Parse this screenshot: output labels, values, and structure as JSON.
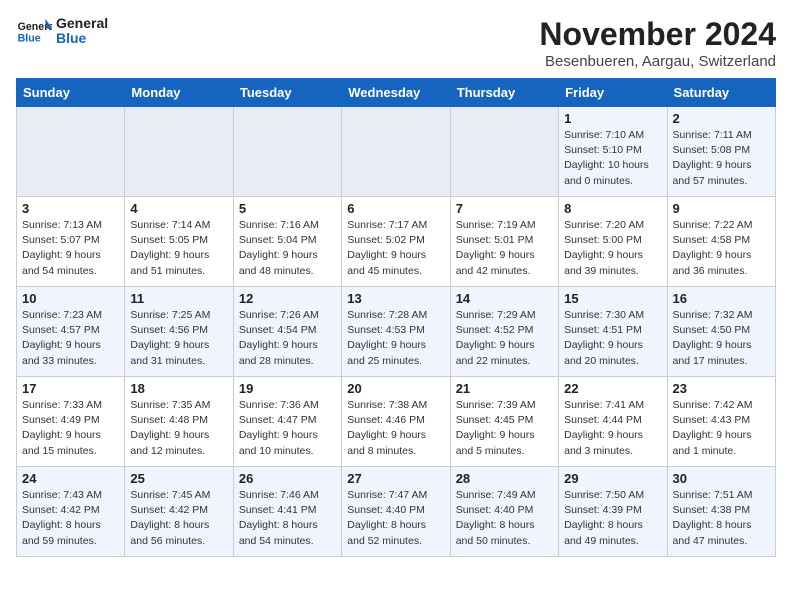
{
  "logo": {
    "line1": "General",
    "line2": "Blue"
  },
  "title": "November 2024",
  "location": "Besenbueren, Aargau, Switzerland",
  "weekdays": [
    "Sunday",
    "Monday",
    "Tuesday",
    "Wednesday",
    "Thursday",
    "Friday",
    "Saturday"
  ],
  "weeks": [
    [
      {
        "day": "",
        "info": ""
      },
      {
        "day": "",
        "info": ""
      },
      {
        "day": "",
        "info": ""
      },
      {
        "day": "",
        "info": ""
      },
      {
        "day": "",
        "info": ""
      },
      {
        "day": "1",
        "info": "Sunrise: 7:10 AM\nSunset: 5:10 PM\nDaylight: 10 hours\nand 0 minutes."
      },
      {
        "day": "2",
        "info": "Sunrise: 7:11 AM\nSunset: 5:08 PM\nDaylight: 9 hours\nand 57 minutes."
      }
    ],
    [
      {
        "day": "3",
        "info": "Sunrise: 7:13 AM\nSunset: 5:07 PM\nDaylight: 9 hours\nand 54 minutes."
      },
      {
        "day": "4",
        "info": "Sunrise: 7:14 AM\nSunset: 5:05 PM\nDaylight: 9 hours\nand 51 minutes."
      },
      {
        "day": "5",
        "info": "Sunrise: 7:16 AM\nSunset: 5:04 PM\nDaylight: 9 hours\nand 48 minutes."
      },
      {
        "day": "6",
        "info": "Sunrise: 7:17 AM\nSunset: 5:02 PM\nDaylight: 9 hours\nand 45 minutes."
      },
      {
        "day": "7",
        "info": "Sunrise: 7:19 AM\nSunset: 5:01 PM\nDaylight: 9 hours\nand 42 minutes."
      },
      {
        "day": "8",
        "info": "Sunrise: 7:20 AM\nSunset: 5:00 PM\nDaylight: 9 hours\nand 39 minutes."
      },
      {
        "day": "9",
        "info": "Sunrise: 7:22 AM\nSunset: 4:58 PM\nDaylight: 9 hours\nand 36 minutes."
      }
    ],
    [
      {
        "day": "10",
        "info": "Sunrise: 7:23 AM\nSunset: 4:57 PM\nDaylight: 9 hours\nand 33 minutes."
      },
      {
        "day": "11",
        "info": "Sunrise: 7:25 AM\nSunset: 4:56 PM\nDaylight: 9 hours\nand 31 minutes."
      },
      {
        "day": "12",
        "info": "Sunrise: 7:26 AM\nSunset: 4:54 PM\nDaylight: 9 hours\nand 28 minutes."
      },
      {
        "day": "13",
        "info": "Sunrise: 7:28 AM\nSunset: 4:53 PM\nDaylight: 9 hours\nand 25 minutes."
      },
      {
        "day": "14",
        "info": "Sunrise: 7:29 AM\nSunset: 4:52 PM\nDaylight: 9 hours\nand 22 minutes."
      },
      {
        "day": "15",
        "info": "Sunrise: 7:30 AM\nSunset: 4:51 PM\nDaylight: 9 hours\nand 20 minutes."
      },
      {
        "day": "16",
        "info": "Sunrise: 7:32 AM\nSunset: 4:50 PM\nDaylight: 9 hours\nand 17 minutes."
      }
    ],
    [
      {
        "day": "17",
        "info": "Sunrise: 7:33 AM\nSunset: 4:49 PM\nDaylight: 9 hours\nand 15 minutes."
      },
      {
        "day": "18",
        "info": "Sunrise: 7:35 AM\nSunset: 4:48 PM\nDaylight: 9 hours\nand 12 minutes."
      },
      {
        "day": "19",
        "info": "Sunrise: 7:36 AM\nSunset: 4:47 PM\nDaylight: 9 hours\nand 10 minutes."
      },
      {
        "day": "20",
        "info": "Sunrise: 7:38 AM\nSunset: 4:46 PM\nDaylight: 9 hours\nand 8 minutes."
      },
      {
        "day": "21",
        "info": "Sunrise: 7:39 AM\nSunset: 4:45 PM\nDaylight: 9 hours\nand 5 minutes."
      },
      {
        "day": "22",
        "info": "Sunrise: 7:41 AM\nSunset: 4:44 PM\nDaylight: 9 hours\nand 3 minutes."
      },
      {
        "day": "23",
        "info": "Sunrise: 7:42 AM\nSunset: 4:43 PM\nDaylight: 9 hours\nand 1 minute."
      }
    ],
    [
      {
        "day": "24",
        "info": "Sunrise: 7:43 AM\nSunset: 4:42 PM\nDaylight: 8 hours\nand 59 minutes."
      },
      {
        "day": "25",
        "info": "Sunrise: 7:45 AM\nSunset: 4:42 PM\nDaylight: 8 hours\nand 56 minutes."
      },
      {
        "day": "26",
        "info": "Sunrise: 7:46 AM\nSunset: 4:41 PM\nDaylight: 8 hours\nand 54 minutes."
      },
      {
        "day": "27",
        "info": "Sunrise: 7:47 AM\nSunset: 4:40 PM\nDaylight: 8 hours\nand 52 minutes."
      },
      {
        "day": "28",
        "info": "Sunrise: 7:49 AM\nSunset: 4:40 PM\nDaylight: 8 hours\nand 50 minutes."
      },
      {
        "day": "29",
        "info": "Sunrise: 7:50 AM\nSunset: 4:39 PM\nDaylight: 8 hours\nand 49 minutes."
      },
      {
        "day": "30",
        "info": "Sunrise: 7:51 AM\nSunset: 4:38 PM\nDaylight: 8 hours\nand 47 minutes."
      }
    ]
  ]
}
